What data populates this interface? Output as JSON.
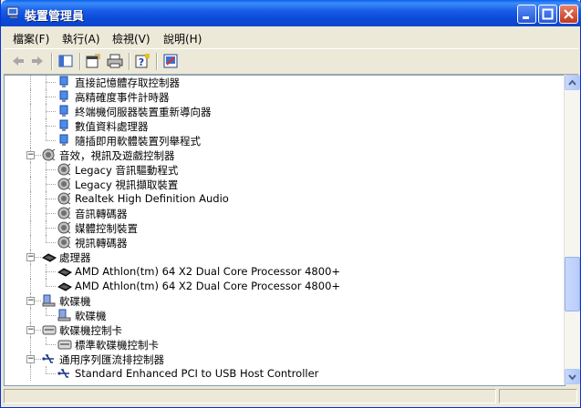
{
  "window": {
    "title": "裝置管理員"
  },
  "menu": [
    "檔案(F)",
    "執行(A)",
    "檢視(V)",
    "說明(H)"
  ],
  "toolbar": [
    "back-icon",
    "forward-icon",
    "show-hide-tree-icon",
    "properties-icon",
    "print-icon",
    "help-icon",
    "scan-hardware-icon"
  ],
  "tree": [
    {
      "label": "直接記憶體存取控制器",
      "icon": "system-device-icon",
      "level": 2
    },
    {
      "label": "高精確度事件計時器",
      "icon": "system-device-icon",
      "level": 2
    },
    {
      "label": "終端機伺服器裝置重新導向器",
      "icon": "system-device-icon",
      "level": 2
    },
    {
      "label": "數值資料處理器",
      "icon": "system-device-icon",
      "level": 2
    },
    {
      "label": "隨插即用軟體裝置列舉程式",
      "icon": "system-device-icon",
      "level": 2
    },
    {
      "label": "音效，視訊及遊戲控制器",
      "icon": "sound-icon",
      "level": 1
    },
    {
      "label": "Legacy 音訊驅動程式",
      "icon": "sound-icon",
      "level": 2
    },
    {
      "label": "Legacy 視訊擷取裝置",
      "icon": "sound-icon",
      "level": 2
    },
    {
      "label": "Realtek High Definition Audio",
      "icon": "sound-icon",
      "level": 2
    },
    {
      "label": "音訊轉碼器",
      "icon": "sound-icon",
      "level": 2
    },
    {
      "label": "媒體控制裝置",
      "icon": "sound-icon",
      "level": 2
    },
    {
      "label": "視訊轉碼器",
      "icon": "sound-icon",
      "level": 2
    },
    {
      "label": "處理器",
      "icon": "processor-icon",
      "level": 1
    },
    {
      "label": "AMD Athlon(tm) 64 X2 Dual Core Processor 4800+",
      "icon": "processor-icon",
      "level": 2
    },
    {
      "label": "AMD Athlon(tm) 64 X2 Dual Core Processor 4800+",
      "icon": "processor-icon",
      "level": 2
    },
    {
      "label": "軟碟機",
      "icon": "floppy-drive-icon",
      "level": 1
    },
    {
      "label": "軟碟機",
      "icon": "floppy-drive-icon",
      "level": 2
    },
    {
      "label": "軟碟機控制卡",
      "icon": "floppy-controller-icon",
      "level": 1
    },
    {
      "label": "標準軟碟機控制卡",
      "icon": "floppy-controller-icon",
      "level": 2
    },
    {
      "label": "通用序列匯流排控制器",
      "icon": "usb-icon",
      "level": 1
    },
    {
      "label": "Standard Enhanced PCI to USB Host Controller",
      "icon": "usb-icon",
      "level": 2
    }
  ],
  "colors": {
    "titlebar": "#0A46CC",
    "window_bg": "#ECE9D8",
    "tree_bg": "#FFFFFF"
  }
}
